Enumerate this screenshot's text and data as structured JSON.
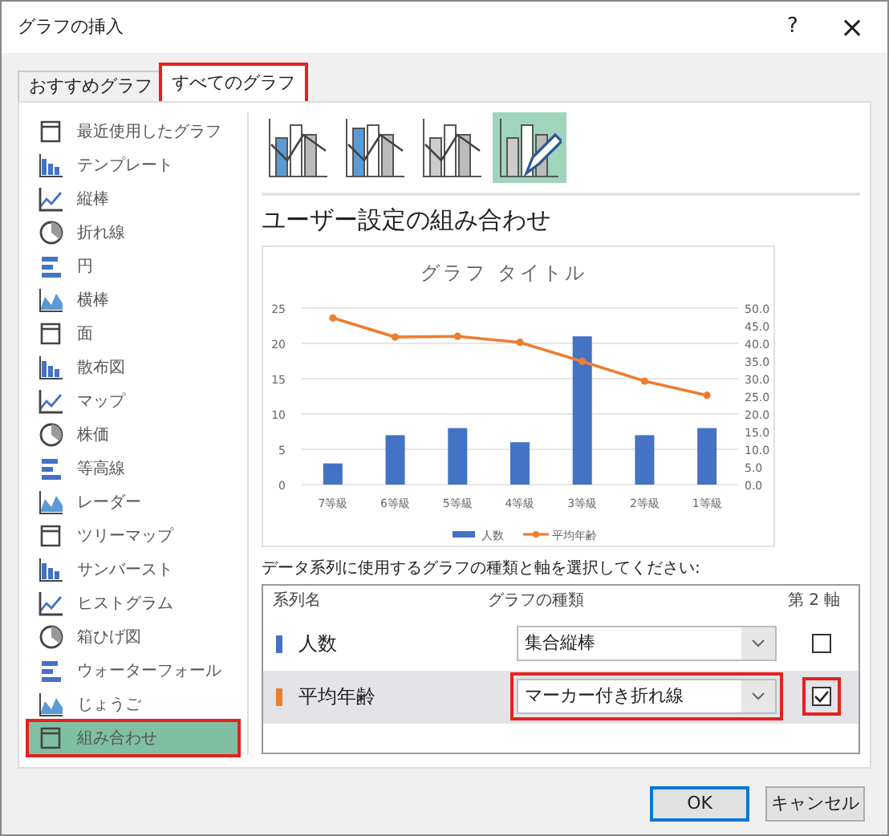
{
  "window": {
    "title": "グラフの挿入",
    "help": "?",
    "close": "×"
  },
  "tabs": [
    {
      "label": "おすすめグラフ",
      "selected": false,
      "highlighted": false
    },
    {
      "label": "すべてのグラフ",
      "selected": true,
      "highlighted": true
    }
  ],
  "sidebar": {
    "items": [
      {
        "label": "最近使用したグラフ",
        "selected": false,
        "highlighted": false
      },
      {
        "label": "テンプレート",
        "selected": false,
        "highlighted": false
      },
      {
        "label": "縦棒",
        "selected": false,
        "highlighted": false
      },
      {
        "label": "折れ線",
        "selected": false,
        "highlighted": false
      },
      {
        "label": "円",
        "selected": false,
        "highlighted": false
      },
      {
        "label": "横棒",
        "selected": false,
        "highlighted": false
      },
      {
        "label": "面",
        "selected": false,
        "highlighted": false
      },
      {
        "label": "散布図",
        "selected": false,
        "highlighted": false
      },
      {
        "label": "マップ",
        "selected": false,
        "highlighted": false
      },
      {
        "label": "株価",
        "selected": false,
        "highlighted": false
      },
      {
        "label": "等高線",
        "selected": false,
        "highlighted": false
      },
      {
        "label": "レーダー",
        "selected": false,
        "highlighted": false
      },
      {
        "label": "ツリーマップ",
        "selected": false,
        "highlighted": false
      },
      {
        "label": "サンバースト",
        "selected": false,
        "highlighted": false
      },
      {
        "label": "ヒストグラム",
        "selected": false,
        "highlighted": false
      },
      {
        "label": "箱ひげ図",
        "selected": false,
        "highlighted": false
      },
      {
        "label": "ウォーターフォール",
        "selected": false,
        "highlighted": false
      },
      {
        "label": "じょうご",
        "selected": false,
        "highlighted": false
      },
      {
        "label": "組み合わせ",
        "selected": true,
        "highlighted": true
      }
    ]
  },
  "subtypes": [
    {
      "selected": false
    },
    {
      "selected": false
    },
    {
      "selected": false
    },
    {
      "selected": true
    }
  ],
  "heading": "ユーザー設定の組み合わせ",
  "chart_data": {
    "type": "bar",
    "title": "グラフ タイトル",
    "grid": true,
    "categories": [
      "7等級",
      "6等級",
      "5等級",
      "4等級",
      "3等級",
      "2等級",
      "1等級"
    ],
    "series": [
      {
        "name": "人数",
        "color": "#4472c4",
        "values": [
          3,
          7,
          8,
          6,
          21,
          7,
          8
        ]
      }
    ],
    "ylim": [
      0,
      25
    ],
    "yticks": [
      0,
      5,
      10,
      15,
      20,
      25
    ]
  },
  "secondary_axis_layer": {
    "chart_data": {
      "type": "line",
      "series": [
        {
          "name": "平均年齢",
          "color": "#ed7d31",
          "marker": true,
          "values": [
            47.2,
            41.8,
            42.0,
            40.3,
            34.9,
            29.3,
            25.3
          ]
        }
      ],
      "ylim": [
        0,
        50
      ],
      "yticks": [
        {
          "value": 0,
          "label": "0.0"
        },
        {
          "value": 5,
          "label": "5.0"
        },
        {
          "value": 10,
          "label": "10.0"
        },
        {
          "value": 15,
          "label": "15.0"
        },
        {
          "value": 20,
          "label": "20.0"
        },
        {
          "value": 25,
          "label": "25.0"
        },
        {
          "value": 30,
          "label": "30.0"
        },
        {
          "value": 35,
          "label": "35.0"
        },
        {
          "value": 40,
          "label": "40.0"
        },
        {
          "value": 45,
          "label": "45.0"
        },
        {
          "value": 50,
          "label": "50.0"
        }
      ]
    }
  },
  "series_prompt": "データ系列に使用するグラフの種類と軸を選択してください:",
  "series_table": {
    "columns": [
      "系列名",
      "グラフの種類",
      "第 2 軸"
    ],
    "rows": [
      {
        "name": "人数",
        "color": "#4472c4",
        "chart_type": "集合縦棒",
        "secondary_axis": false,
        "selected": false,
        "highlighted": false
      },
      {
        "name": "平均年齢",
        "color": "#ed7d31",
        "chart_type": "マーカー付き折れ線",
        "secondary_axis": true,
        "selected": true,
        "highlighted": true
      }
    ]
  },
  "buttons": [
    {
      "label": "OK",
      "default": true
    },
    {
      "label": "キャンセル",
      "default": false
    }
  ]
}
